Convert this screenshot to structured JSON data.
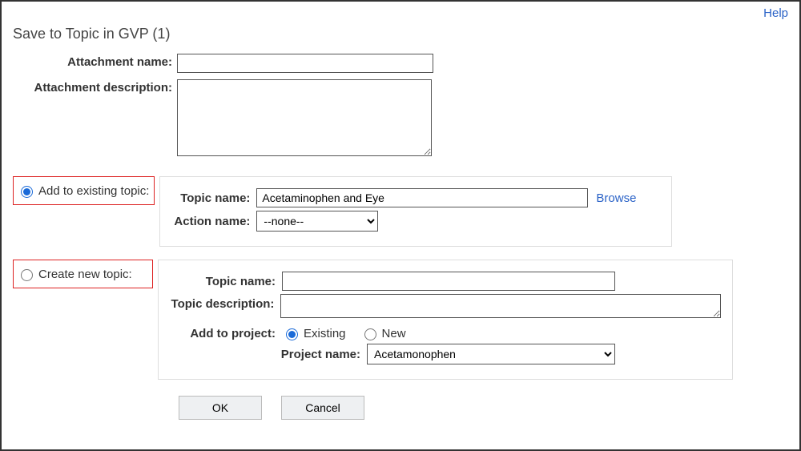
{
  "help_label": "Help",
  "page_title": "Save to Topic in GVP (1)",
  "attach": {
    "name_label": "Attachment name:",
    "name_value": "",
    "desc_label": "Attachment description:",
    "desc_value": ""
  },
  "choice": {
    "existing_label": "Add to existing topic:",
    "create_label": "Create new topic:"
  },
  "existing": {
    "topic_name_label": "Topic name:",
    "topic_name_value": "Acetaminophen and Eye",
    "browse_label": "Browse",
    "action_name_label": "Action name:",
    "action_name_value": "--none--"
  },
  "create": {
    "topic_name_label": "Topic name:",
    "topic_name_value": "",
    "topic_desc_label": "Topic description:",
    "topic_desc_value": "",
    "add_to_project_label": "Add to project:",
    "existing_label": "Existing",
    "new_label": "New",
    "project_name_label": "Project name:",
    "project_name_value": "Acetamonophen"
  },
  "buttons": {
    "ok": "OK",
    "cancel": "Cancel"
  }
}
